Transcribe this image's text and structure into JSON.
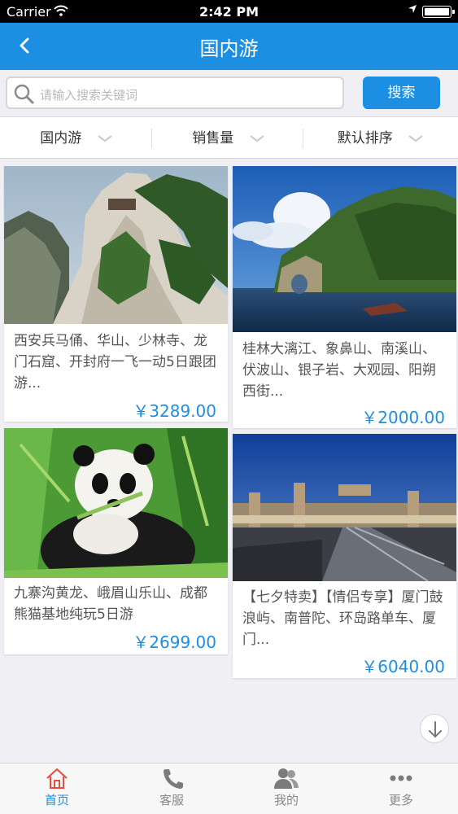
{
  "status_bar": {
    "carrier": "Carrier",
    "time": "2:42 PM"
  },
  "nav": {
    "title": "国内游"
  },
  "search": {
    "placeholder": "请输入搜索关键词",
    "button_label": "搜索"
  },
  "filters": [
    {
      "label": "国内游"
    },
    {
      "label": "销售量"
    },
    {
      "label": "默认排序"
    }
  ],
  "products": [
    {
      "description": "西安兵马俑、华山、少林寺、龙门石窟、开封府一飞一动5日跟团游...",
      "price": "￥3289.00",
      "image_icon": "mountain-cliff-photo"
    },
    {
      "description": "桂林大漓江、象鼻山、南溪山、伏波山、银子岩、大观园、阳朔西街...",
      "price": "￥2000.00",
      "image_icon": "river-karst-photo"
    },
    {
      "description": "九寨沟黄龙、峨眉山乐山、成都熊猫基地纯玩5日游",
      "price": "￥2699.00",
      "image_icon": "panda-photo"
    },
    {
      "description": "【七夕特卖】【情侣专享】厦门鼓浪屿、南普陀、环岛路单车、厦门...",
      "price": "￥6040.00",
      "image_icon": "ferry-terminal-photo"
    }
  ],
  "tabs": [
    {
      "label": "首页",
      "icon": "home-icon",
      "active": true
    },
    {
      "label": "客服",
      "icon": "phone-icon",
      "active": false
    },
    {
      "label": "我的",
      "icon": "user-icon",
      "active": false
    },
    {
      "label": "更多",
      "icon": "more-icon",
      "active": false
    }
  ],
  "colors": {
    "accent": "#1c8fe3",
    "background": "#efeff4"
  }
}
